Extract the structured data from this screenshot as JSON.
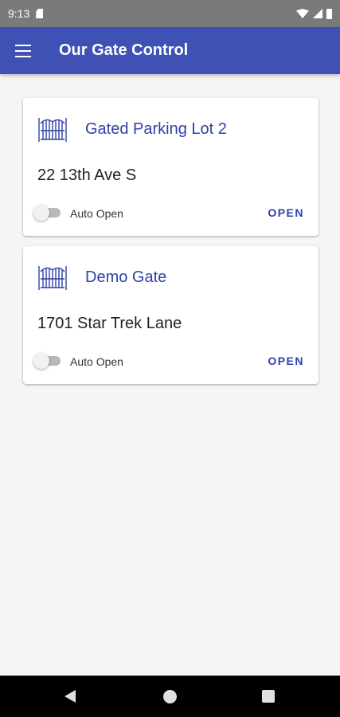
{
  "status_bar": {
    "time": "9:13",
    "icons": [
      "sd-card-icon",
      "wifi-icon",
      "signal-icon",
      "battery-icon"
    ]
  },
  "app_bar": {
    "title": "Our Gate Control",
    "menu_icon": "menu-icon"
  },
  "colors": {
    "primary": "#3f51b5",
    "accent_text": "#3040a8",
    "status_bar": "#7a7a7a",
    "background": "#f5f5f5"
  },
  "gates": [
    {
      "icon": "gate-icon",
      "name": "Gated Parking Lot 2",
      "address": "22 13th Ave S",
      "auto_open_label": "Auto Open",
      "auto_open_enabled": false,
      "open_label": "OPEN"
    },
    {
      "icon": "gate-icon",
      "name": "Demo Gate",
      "address": "1701 Star Trek Lane",
      "auto_open_label": "Auto Open",
      "auto_open_enabled": false,
      "open_label": "OPEN"
    }
  ],
  "nav_bar": {
    "icons": [
      "back-icon",
      "home-icon",
      "recents-icon"
    ]
  }
}
